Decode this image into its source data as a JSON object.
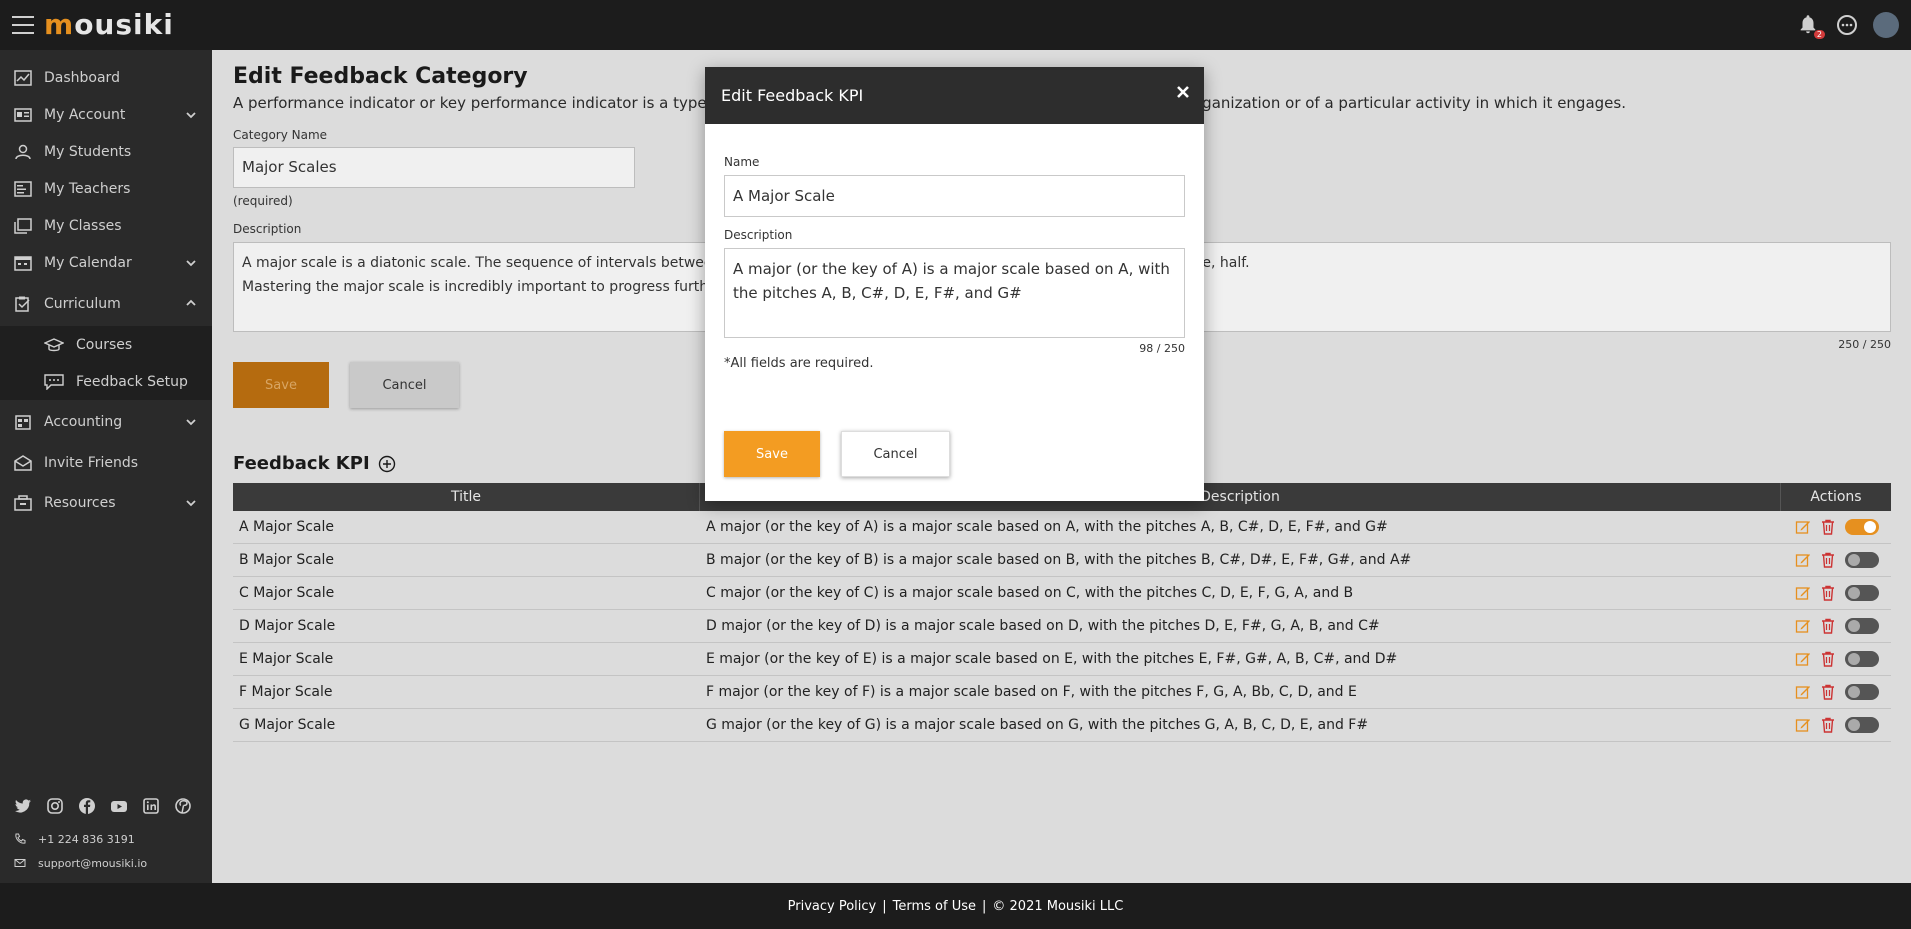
{
  "app": {
    "logo_first": "m",
    "logo_rest": "ousiki",
    "notification_count": "2"
  },
  "sidebar": {
    "items": [
      {
        "label": "Dashboard",
        "icon": "dashboard-icon"
      },
      {
        "label": "My Account",
        "icon": "id-card-icon",
        "expandable": true
      },
      {
        "label": "My Students",
        "icon": "user-icon"
      },
      {
        "label": "My Teachers",
        "icon": "teacher-icon"
      },
      {
        "label": "My Classes",
        "icon": "classes-icon"
      },
      {
        "label": "My Calendar",
        "icon": "calendar-icon",
        "expandable": true
      },
      {
        "label": "Curriculum",
        "icon": "curriculum-icon",
        "expanded": true
      }
    ],
    "sub_items": [
      {
        "label": "Courses",
        "icon": "graduation-cap-icon"
      },
      {
        "label": "Feedback Setup",
        "icon": "comment-icon"
      }
    ],
    "items_after": [
      {
        "label": "Accounting",
        "icon": "accounting-icon",
        "expandable": true
      },
      {
        "label": "Invite Friends",
        "icon": "envelope-icon"
      },
      {
        "label": "Resources",
        "icon": "resources-icon",
        "expandable": true
      }
    ],
    "phone": "+1 224 836 3191",
    "email": "support@mousiki.io"
  },
  "page": {
    "title": "Edit Feedback Category",
    "subtitle": "A performance indicator or key performance indicator is a type of performance measurement. KPIs evaluate the success of an organization or of a particular activity in which it engages.",
    "category_label": "Category Name",
    "category_value": "Major Scales",
    "required_text": "(required)",
    "description_label": "Description",
    "description_line1": "A major scale is a diatonic scale. The sequence of intervals between the notes of a major scale is: whole, whole, half, whole, whole, whole, half.",
    "description_line2": "Mastering the major scale is incredibly important to progress further with music theory and performance.",
    "description_counter": "250 / 250",
    "save_label": "Save",
    "cancel_label": "Cancel",
    "kpi_section_title": "Feedback KPI"
  },
  "table": {
    "columns": [
      "Title",
      "Description",
      "Actions"
    ],
    "rows": [
      {
        "title": "A Major Scale",
        "description": "A major (or the key of A) is a major scale based on A, with the pitches A, B, C#, D, E, F#, and G#",
        "active": true
      },
      {
        "title": "B Major Scale",
        "description": "B major (or the key of B) is a major scale based on B, with the pitches B, C#, D#, E, F#, G#, and A#",
        "active": false
      },
      {
        "title": "C Major Scale",
        "description": "C major (or the key of C) is a major scale based on C, with the pitches C, D, E, F, G, A, and B",
        "active": false
      },
      {
        "title": "D Major Scale",
        "description": "D major (or the key of D) is a major scale based on D, with the pitches D, E, F#, G, A, B, and C#",
        "active": false
      },
      {
        "title": "E Major Scale",
        "description": "E major (or the key of E) is a major scale based on E, with the pitches E, F#, G#, A, B, C#, and D#",
        "active": false
      },
      {
        "title": "F Major Scale",
        "description": "F major (or the key of F) is a major scale based on F, with the pitches F, G, A, Bb, C, D, and E",
        "active": false
      },
      {
        "title": "G Major Scale",
        "description": "G major (or the key of G) is a major scale based on G, with the pitches G, A, B, C, D, E, and F#",
        "active": false
      }
    ]
  },
  "modal": {
    "title": "Edit Feedback KPI",
    "name_label": "Name",
    "name_value": "A Major Scale",
    "description_label": "Description",
    "description_value": "A major (or the key of A) is a major scale based on A, with the pitches A, B, C#, D, E, F#, and G#",
    "counter": "98 / 250",
    "note": "*All fields are required.",
    "save_label": "Save",
    "cancel_label": "Cancel"
  },
  "footer": {
    "privacy": "Privacy Policy",
    "terms": "Terms of Use",
    "copyright": "© 2021 Mousiki LLC",
    "separator": "|"
  },
  "colors": {
    "accent": "#f39c22",
    "dark": "#1c1c1c",
    "sidebar": "#2a2a2a"
  }
}
